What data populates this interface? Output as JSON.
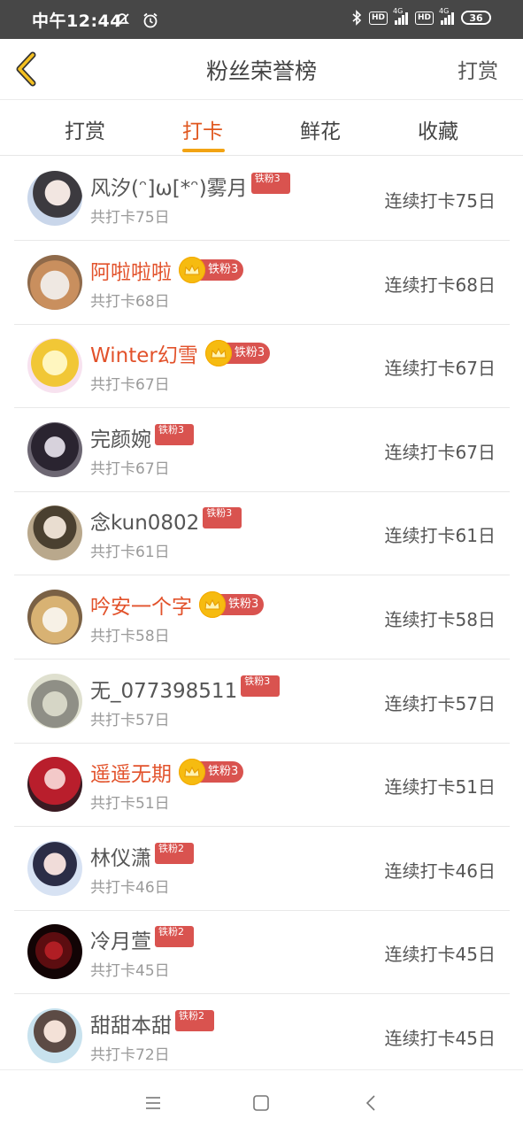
{
  "status_bar": {
    "time": "中午12:44",
    "hd1": "HD",
    "hd2": "HD",
    "net1": "4G",
    "net2": "4G",
    "battery": "36"
  },
  "header": {
    "title": "粉丝荣誉榜",
    "reward_label": "打赏"
  },
  "tabs": [
    {
      "label": "打赏",
      "active": false
    },
    {
      "label": "打卡",
      "active": true
    },
    {
      "label": "鲜花",
      "active": false
    },
    {
      "label": "收藏",
      "active": false
    }
  ],
  "rows": [
    {
      "name": "风汐(ᵔ]ω[*ᵔ)雾月",
      "vip": false,
      "badge": "铁粉3",
      "total": "共打卡75日",
      "streak": "连续打卡75日"
    },
    {
      "name": "阿啦啦啦",
      "vip": true,
      "badge": "铁粉3",
      "total": "共打卡68日",
      "streak": "连续打卡68日"
    },
    {
      "name": "Winter幻雪",
      "vip": true,
      "badge": "铁粉3",
      "total": "共打卡67日",
      "streak": "连续打卡67日"
    },
    {
      "name": "完颜婉",
      "vip": false,
      "badge": "铁粉3",
      "total": "共打卡67日",
      "streak": "连续打卡67日"
    },
    {
      "name": "念kun0802",
      "vip": false,
      "badge": "铁粉3",
      "total": "共打卡61日",
      "streak": "连续打卡61日"
    },
    {
      "name": "吟安一个字",
      "vip": true,
      "badge": "铁粉3",
      "total": "共打卡58日",
      "streak": "连续打卡58日"
    },
    {
      "name": "无_077398511",
      "vip": false,
      "badge": "铁粉3",
      "total": "共打卡57日",
      "streak": "连续打卡57日"
    },
    {
      "name": "遥遥无期",
      "vip": true,
      "badge": "铁粉3",
      "total": "共打卡51日",
      "streak": "连续打卡51日"
    },
    {
      "name": "林仪潇",
      "vip": false,
      "badge": "铁粉2",
      "total": "共打卡46日",
      "streak": "连续打卡46日"
    },
    {
      "name": "冷月萱",
      "vip": false,
      "badge": "铁粉2",
      "total": "共打卡45日",
      "streak": "连续打卡45日"
    },
    {
      "name": "甜甜本甜",
      "vip": false,
      "badge": "铁粉2",
      "total": "共打卡72日",
      "streak": "连续打卡45日"
    }
  ],
  "colors": {
    "accent": "#f2a313",
    "vip_name": "#e2522b",
    "badge": "#d9534f",
    "crown": "#f6bb10",
    "status_bar": "#474747"
  },
  "icons": {
    "back": "chevron-left-icon",
    "crown": "crown-icon",
    "nav": [
      "menu-icon",
      "home-square-icon",
      "back-triangle-icon"
    ]
  }
}
